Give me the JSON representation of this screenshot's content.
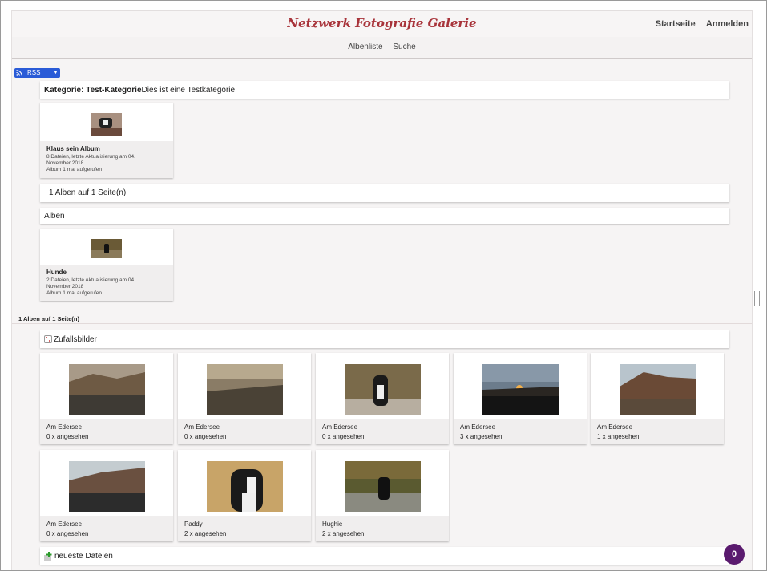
{
  "header": {
    "title": "Netzwerk Fotografie Galerie",
    "nav_home": "Startseite",
    "nav_login": "Anmelden"
  },
  "subnav": {
    "album_list": "Albenliste",
    "search": "Suche"
  },
  "rss": {
    "label": "RSS"
  },
  "category": {
    "prefix": "Kategorie: ",
    "name": "Test-Kategorie",
    "description": "Dies ist eine Testkategorie"
  },
  "category_albums": [
    {
      "name": "Klaus sein Album",
      "meta_line1": "8 Dateien, letzte Aktualisierung am 04.",
      "meta_line2": "November 2018",
      "meta_line3": "Album 1 mal aufgerufen"
    }
  ],
  "pager_inner": "1 Alben auf 1 Seite(n)",
  "albums_heading": "Alben",
  "albums": [
    {
      "name": "Hunde",
      "meta_line1": "2 Dateien, letzte Aktualisierung am 04.",
      "meta_line2": "November 2018",
      "meta_line3": "Album 1 mal aufgerufen"
    }
  ],
  "pager_outer": "1 Alben auf 1 Seite(n)",
  "random_heading": "Zufallsbilder",
  "random_photos": [
    {
      "title": "Am Edersee",
      "views": "0 x angesehen"
    },
    {
      "title": "Am Edersee",
      "views": "0 x angesehen"
    },
    {
      "title": "Am Edersee",
      "views": "0 x angesehen"
    },
    {
      "title": "Am Edersee",
      "views": "3 x angesehen"
    },
    {
      "title": "Am Edersee",
      "views": "1 x angesehen"
    },
    {
      "title": "Am Edersee",
      "views": "0 x angesehen"
    },
    {
      "title": "Paddy",
      "views": "2 x angesehen"
    },
    {
      "title": "Hughie",
      "views": "2 x angesehen"
    }
  ],
  "newest_heading": "neueste Dateien",
  "badge_count": "0",
  "icons": {
    "rss": "rss-feed-icon",
    "dropdown": "caret-down-icon",
    "random": "dice-icon",
    "newest": "plus-icon",
    "scroll": "resize-grip-icon"
  },
  "colors": {
    "title": "#a8333a",
    "rss": "#2a5bd7",
    "badge": "#5a1a6e"
  }
}
